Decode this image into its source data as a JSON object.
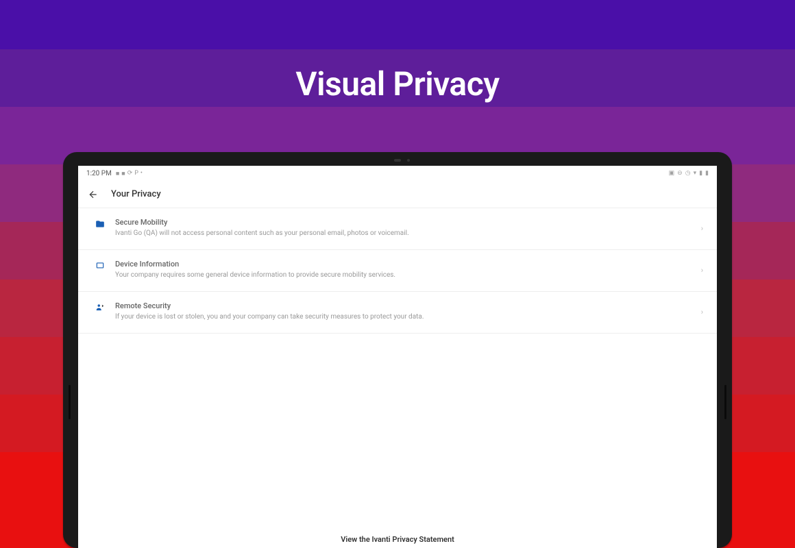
{
  "promo": {
    "title": "Visual Privacy"
  },
  "statusBar": {
    "time": "1:20 PM",
    "leftIcons": [
      "folder",
      "folder",
      "sync",
      "P",
      "dot"
    ],
    "rightIcons": [
      "cast",
      "do-not-disturb",
      "wifi",
      "signal",
      "battery"
    ]
  },
  "appBar": {
    "title": "Your Privacy"
  },
  "items": [
    {
      "icon": "folder-locked",
      "title": "Secure Mobility",
      "description": "Ivanti Go (QA) will not access personal content such as your personal email, photos or voicemail."
    },
    {
      "icon": "device",
      "title": "Device Information",
      "description": "Your company requires some general device information to provide secure mobility services."
    },
    {
      "icon": "remote-security",
      "title": "Remote Security",
      "description": "If your device is lost or stolen, you and your company can take security measures to protect your data."
    }
  ],
  "footer": {
    "linkText": "View the Ivanti Privacy Statement"
  }
}
